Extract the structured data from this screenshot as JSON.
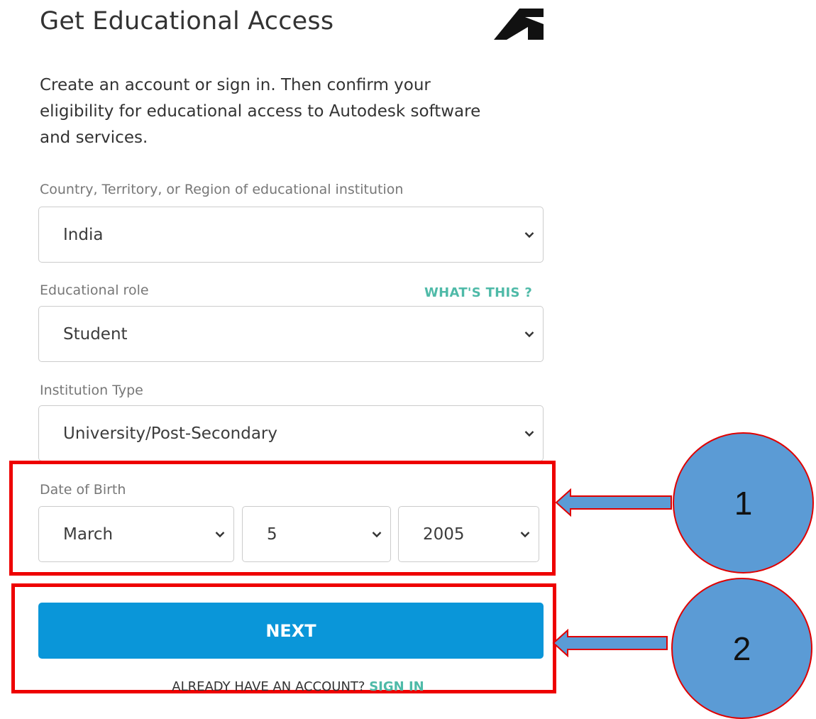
{
  "page": {
    "title": "Get Educational Access",
    "logo": "autodesk-logo",
    "intro": "Create an account or sign in. Then confirm your eligibility for educational access to Autodesk software and services."
  },
  "form": {
    "country": {
      "label": "Country, Territory, or Region of educational institution",
      "value": "India"
    },
    "role": {
      "label": "Educational role",
      "value": "Student",
      "help_link": "WHAT'S THIS ?"
    },
    "institution": {
      "label": "Institution Type",
      "value": "University/Post-Secondary"
    },
    "dob": {
      "label": "Date of Birth",
      "month": "March",
      "day": "5",
      "year": "2005"
    },
    "next_label": "NEXT",
    "already_text": "ALREADY HAVE AN ACCOUNT?",
    "sign_in_label": "SIGN IN"
  },
  "annotations": {
    "step1": "1",
    "step2": "2",
    "color": "#5b9bd5",
    "highlight_color": "#ee0000"
  }
}
